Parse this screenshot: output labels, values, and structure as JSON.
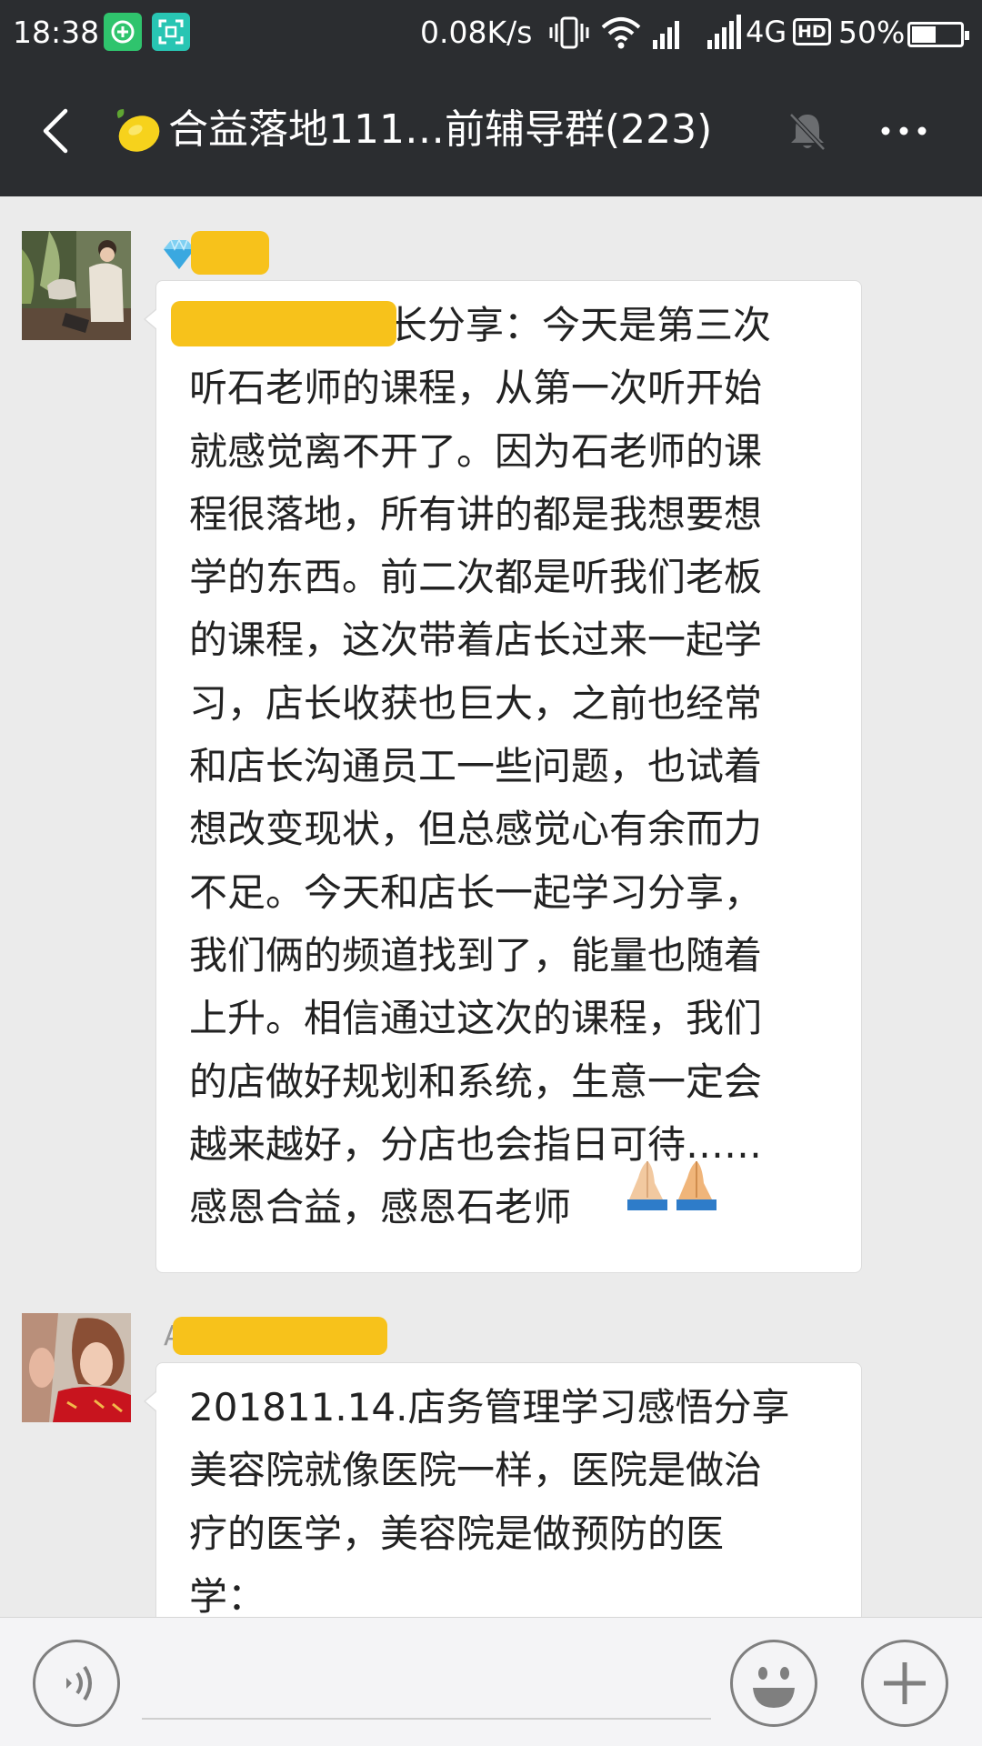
{
  "status_bar": {
    "time": "18:38",
    "net_speed": "0.08K/s",
    "network_type": "4G",
    "hd_label": "HD",
    "battery": "50%",
    "battery_level": 0.5
  },
  "header": {
    "title": "合益落地111…前辅导群(223)",
    "title_emoji": "lemon",
    "muted": true
  },
  "messages": [
    {
      "sender_visible": "",
      "sender_badge": "diamond",
      "text": "长分享：今天是第三次\n听石老师的课程，从第一次听开始\n就感觉离不开了。因为石老师的课\n程很落地，所有讲的都是我想要想\n学的东西。前二次都是听我们老板\n的课程，这次带着店长过来一起学\n习，店长收获也巨大，之前也经常\n和店长沟通员工一些问题，也试着\n想改变现状，但总感觉心有余而力\n不足。今天和店长一起学习分享，\n我们俩的频道找到了，能量也随着\n上升。相信通过这次的课程，我们\n的店做好规划和系统，生意一定会\n越来越好，分店也会指日可待……\n感恩合益，感恩石老师",
      "trailing_emoji": "folded-hands x2"
    },
    {
      "sender_visible": "A",
      "text": "201811.14.店务管理学习感悟分享\n美容院就像医院一样，医院是做治\n疗的医学，美容院是做预防的医\n学："
    }
  ],
  "input_bar": {
    "placeholder": ""
  },
  "colors": {
    "header_bg": "#2b2d30",
    "chat_bg": "#ebebeb",
    "bubble_bg": "#ffffff",
    "redaction": "#f7c21b"
  }
}
